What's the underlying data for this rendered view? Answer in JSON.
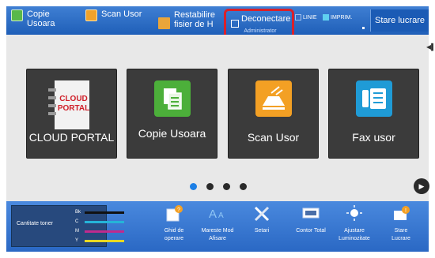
{
  "topbar": {
    "copy_easy": "Copie Usoara",
    "scan_easy": "Scan Usor",
    "restore_file": "Restabilire fisier de H",
    "logout": "Deconectare",
    "logout_user": "Administrator",
    "status_line": "LINIE",
    "status_print": "IMPRIM.",
    "job_status": "Stare lucrare"
  },
  "tiles": [
    {
      "label": "CLOUD PORTAL",
      "icon": "cloud-portal-icon",
      "logo_text": "CLOUD PORTAL"
    },
    {
      "label": "Copie Usoara",
      "icon": "copy-icon"
    },
    {
      "label": "Scan Usor",
      "icon": "scan-icon"
    },
    {
      "label": "Fax usor",
      "icon": "fax-icon"
    }
  ],
  "pagination": {
    "pages": 4,
    "current": 1
  },
  "toner": {
    "title": "Cantitate toner",
    "labels": [
      "Bk",
      "C",
      "M",
      "Y"
    ],
    "colors": [
      "#111111",
      "#25b4d8",
      "#c02a8e",
      "#e8d823"
    ]
  },
  "bottom": {
    "guide": "Ghid de operare",
    "large_mode": "Mareste Mod Afisare",
    "settings": "Setari",
    "counter": "Contor Total",
    "brightness": "Ajustare Luminozitate",
    "job_status": "Stare Lucrare"
  }
}
